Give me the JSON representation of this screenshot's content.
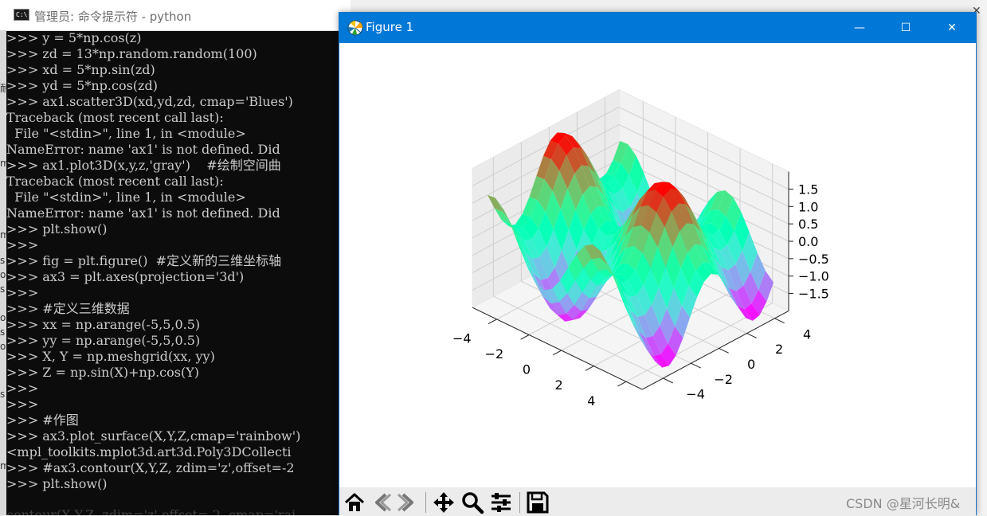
{
  "cmd": {
    "title": "管理员: 命令提示符 - python",
    "icon_label": "C:\\",
    "lines": [
      ">>> y = 5*np.cos(z)",
      ">>> zd = 13*np.random.random(100)",
      ">>> xd = 5*np.sin(zd)",
      ">>> yd = 5*np.cos(zd)",
      ">>> ax1.scatter3D(xd,yd,zd, cmap='Blues')",
      "Traceback (most recent call last):",
      "  File \"<stdin>\", line 1, in <module>",
      "NameError: name 'ax1' is not defined. Did",
      ">>> ax1.plot3D(x,y,z,'gray')    #绘制空间曲",
      "Traceback (most recent call last):",
      "  File \"<stdin>\", line 1, in <module>",
      "NameError: name 'ax1' is not defined. Did",
      ">>> plt.show()",
      ">>>",
      ">>> fig = plt.figure()  #定义新的三维坐标轴",
      ">>> ax3 = plt.axes(projection='3d')",
      ">>>",
      ">>> #定义三维数据",
      ">>> xx = np.arange(-5,5,0.5)",
      ">>> yy = np.arange(-5,5,0.5)",
      ">>> X, Y = np.meshgrid(xx, yy)",
      ">>> Z = np.sin(X)+np.cos(Y)",
      ">>>",
      ">>>",
      ">>> #作图",
      ">>> ax3.plot_surface(X,Y,Z,cmap='rainbow')",
      "<mpl_toolkits.mplot3d.art3d.Poly3DCollecti",
      ">>> #ax3.contour(X,Y,Z, zdim='z',offset=-2",
      ">>> plt.show()"
    ],
    "tail_line": "contour(X,Y,Z, zdim='z',offset=-2, cmap='rai"
  },
  "side_chars": [
    "耐",
    "m",
    "m",
    "s",
    "o",
    "s",
    "o",
    "s",
    "o",
    "s",
    "m"
  ],
  "figure": {
    "title": "Figure 1",
    "buttons": {
      "minimize": "—",
      "maximize": "☐",
      "close": "✕"
    }
  },
  "toolbar": {
    "icons": [
      "home-icon",
      "back-icon",
      "forward-icon",
      "pan-icon",
      "zoom-icon",
      "configure-subplots-icon",
      "save-icon"
    ]
  },
  "watermark": "CSDN @星河长明&",
  "chart_data": {
    "type": "surface",
    "z_function": "sin(x)+cos(y)",
    "x_range": [
      -5,
      4.5
    ],
    "y_range": [
      -5,
      4.5
    ],
    "step": 0.5,
    "cmap": "rainbow",
    "x_ticks": [
      "−4",
      "−2",
      "0",
      "2",
      "4"
    ],
    "y_ticks": [
      "−4",
      "−2",
      "0",
      "2",
      "4"
    ],
    "z_ticks": [
      "1.5",
      "1.0",
      "0.5",
      "0.0",
      "−0.5",
      "−1.0",
      "−1.5"
    ],
    "x_tick_values": [
      -4,
      -2,
      0,
      2,
      4
    ],
    "y_tick_values": [
      -4,
      -2,
      0,
      2,
      4
    ],
    "z_tick_values": [
      1.5,
      1.0,
      0.5,
      0.0,
      -0.5,
      -1.0,
      -1.5
    ],
    "zlim": [
      -2,
      2
    ]
  }
}
